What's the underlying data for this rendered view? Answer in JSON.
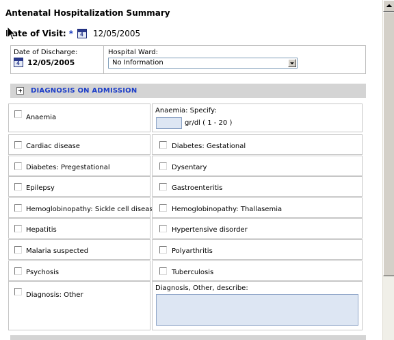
{
  "header": {
    "title": "Antenatal Hospitalization Summary",
    "visit_label": "Date of Visit:",
    "required_mark": "*",
    "visit_date": "12/05/2005"
  },
  "discharge": {
    "label": "Date of Discharge:",
    "date": "12/05/2005",
    "ward_label": "Hospital Ward:",
    "ward_selected": "No Information"
  },
  "section": {
    "title": "DIAGNOSIS ON ADMISSION"
  },
  "anaemia": {
    "checkbox_label": "Anaemia",
    "specify_label": "Anaemia: Specify:",
    "unit": "gr/dl ( 1 - 20 )"
  },
  "diagnoses": [
    {
      "left": "Cardiac disease",
      "right": "Diabetes: Gestational"
    },
    {
      "left": "Diabetes: Pregestational",
      "right": "Dysentary"
    },
    {
      "left": "Epilepsy",
      "right": "Gastroenteritis"
    },
    {
      "left": "Hemoglobinopathy: Sickle cell disease",
      "right": "Hemoglobinopathy: Thallasemia"
    },
    {
      "left": "Hepatitis",
      "right": "Hypertensive disorder"
    },
    {
      "left": "Malaria suspected",
      "right": "Polyarthritis"
    },
    {
      "left": "Psychosis",
      "right": "Tuberculosis"
    }
  ],
  "other": {
    "checkbox_label": "Diagnosis: Other",
    "describe_label": "Diagnosis, Other, describe:"
  },
  "icons": {
    "calendar": "calendar-icon",
    "expand": "expand-plus-icon",
    "cursor": "mouse-pointer-icon",
    "dropdown": "chevron-down-icon"
  }
}
